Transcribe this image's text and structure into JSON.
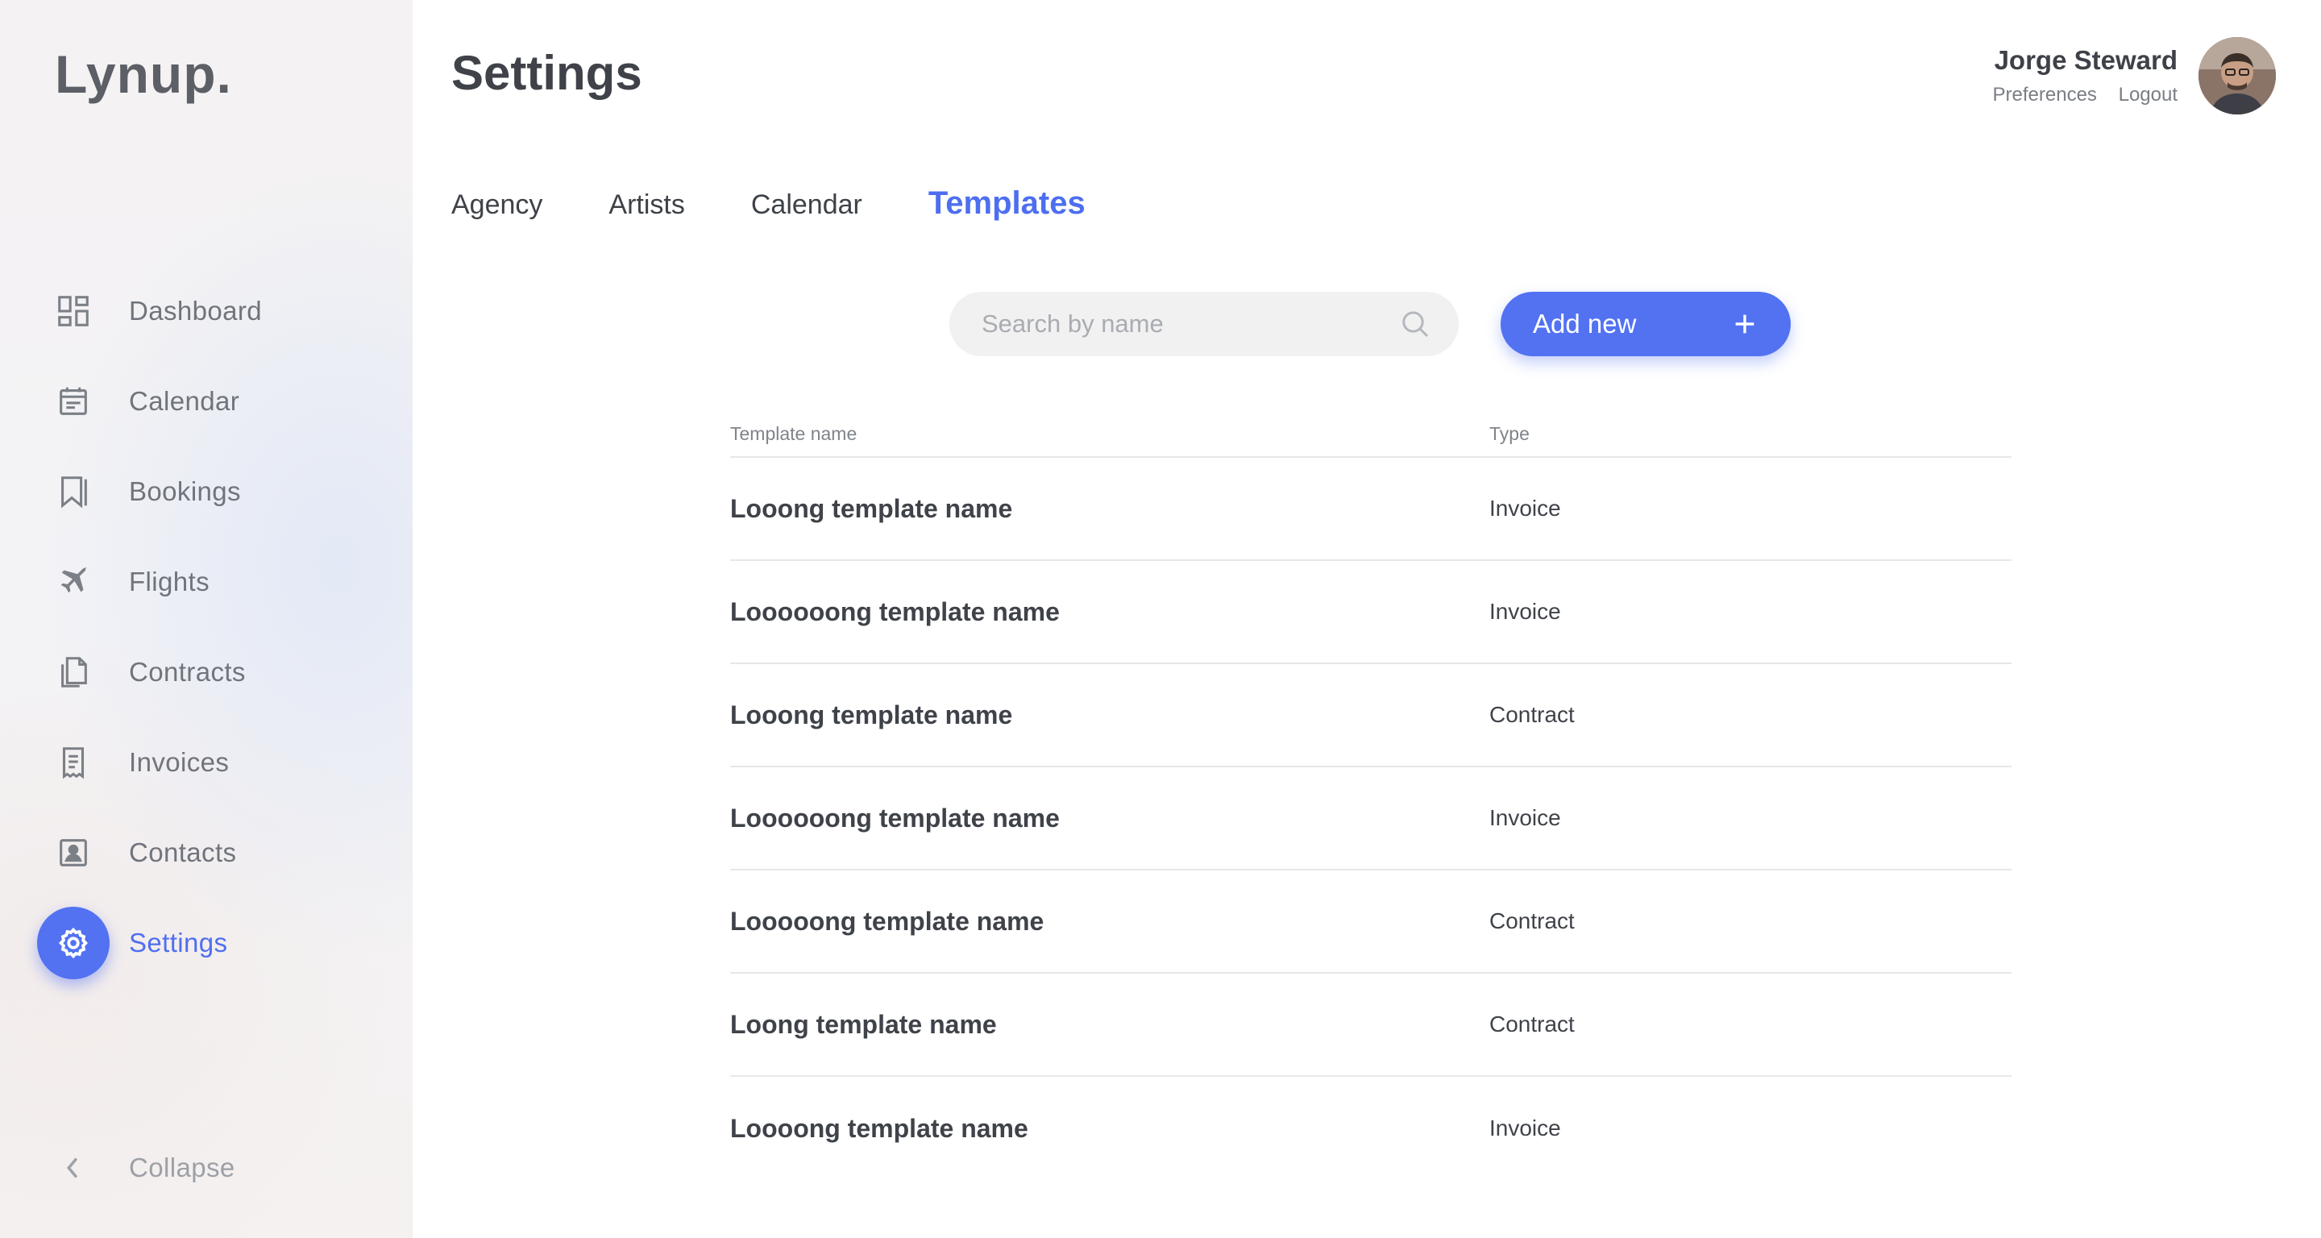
{
  "app": {
    "logo": "Lynup."
  },
  "sidebar": {
    "items": [
      {
        "label": "Dashboard",
        "icon": "dashboard-icon"
      },
      {
        "label": "Calendar",
        "icon": "calendar-icon"
      },
      {
        "label": "Bookings",
        "icon": "bookmark-icon"
      },
      {
        "label": "Flights",
        "icon": "plane-icon"
      },
      {
        "label": "Contracts",
        "icon": "documents-icon"
      },
      {
        "label": "Invoices",
        "icon": "receipt-icon"
      },
      {
        "label": "Contacts",
        "icon": "contact-card-icon"
      },
      {
        "label": "Settings",
        "icon": "gear-icon",
        "active": true
      }
    ],
    "collapse_label": "Collapse"
  },
  "header": {
    "title": "Settings",
    "user": {
      "name": "Jorge Steward",
      "preferences_label": "Preferences",
      "logout_label": "Logout"
    }
  },
  "tabs": [
    {
      "label": "Agency"
    },
    {
      "label": "Artists"
    },
    {
      "label": "Calendar"
    },
    {
      "label": "Templates",
      "active": true
    }
  ],
  "search": {
    "placeholder": "Search by name",
    "value": ""
  },
  "add_button": {
    "label": "Add new"
  },
  "table": {
    "columns": [
      "Template name",
      "Type"
    ],
    "rows": [
      {
        "name": "Looong template name",
        "type": "Invoice"
      },
      {
        "name": "Loooooong template name",
        "type": "Invoice"
      },
      {
        "name": "Looong template name",
        "type": "Contract"
      },
      {
        "name": "Loooooong template name",
        "type": "Invoice"
      },
      {
        "name": "Looooong template name",
        "type": "Contract"
      },
      {
        "name": "Loong template name",
        "type": "Contract"
      },
      {
        "name": "Loooong template name",
        "type": "Invoice"
      }
    ]
  },
  "colors": {
    "accent": "#5272f2",
    "sidebar_text": "#70747b",
    "heading": "#3f4349"
  }
}
